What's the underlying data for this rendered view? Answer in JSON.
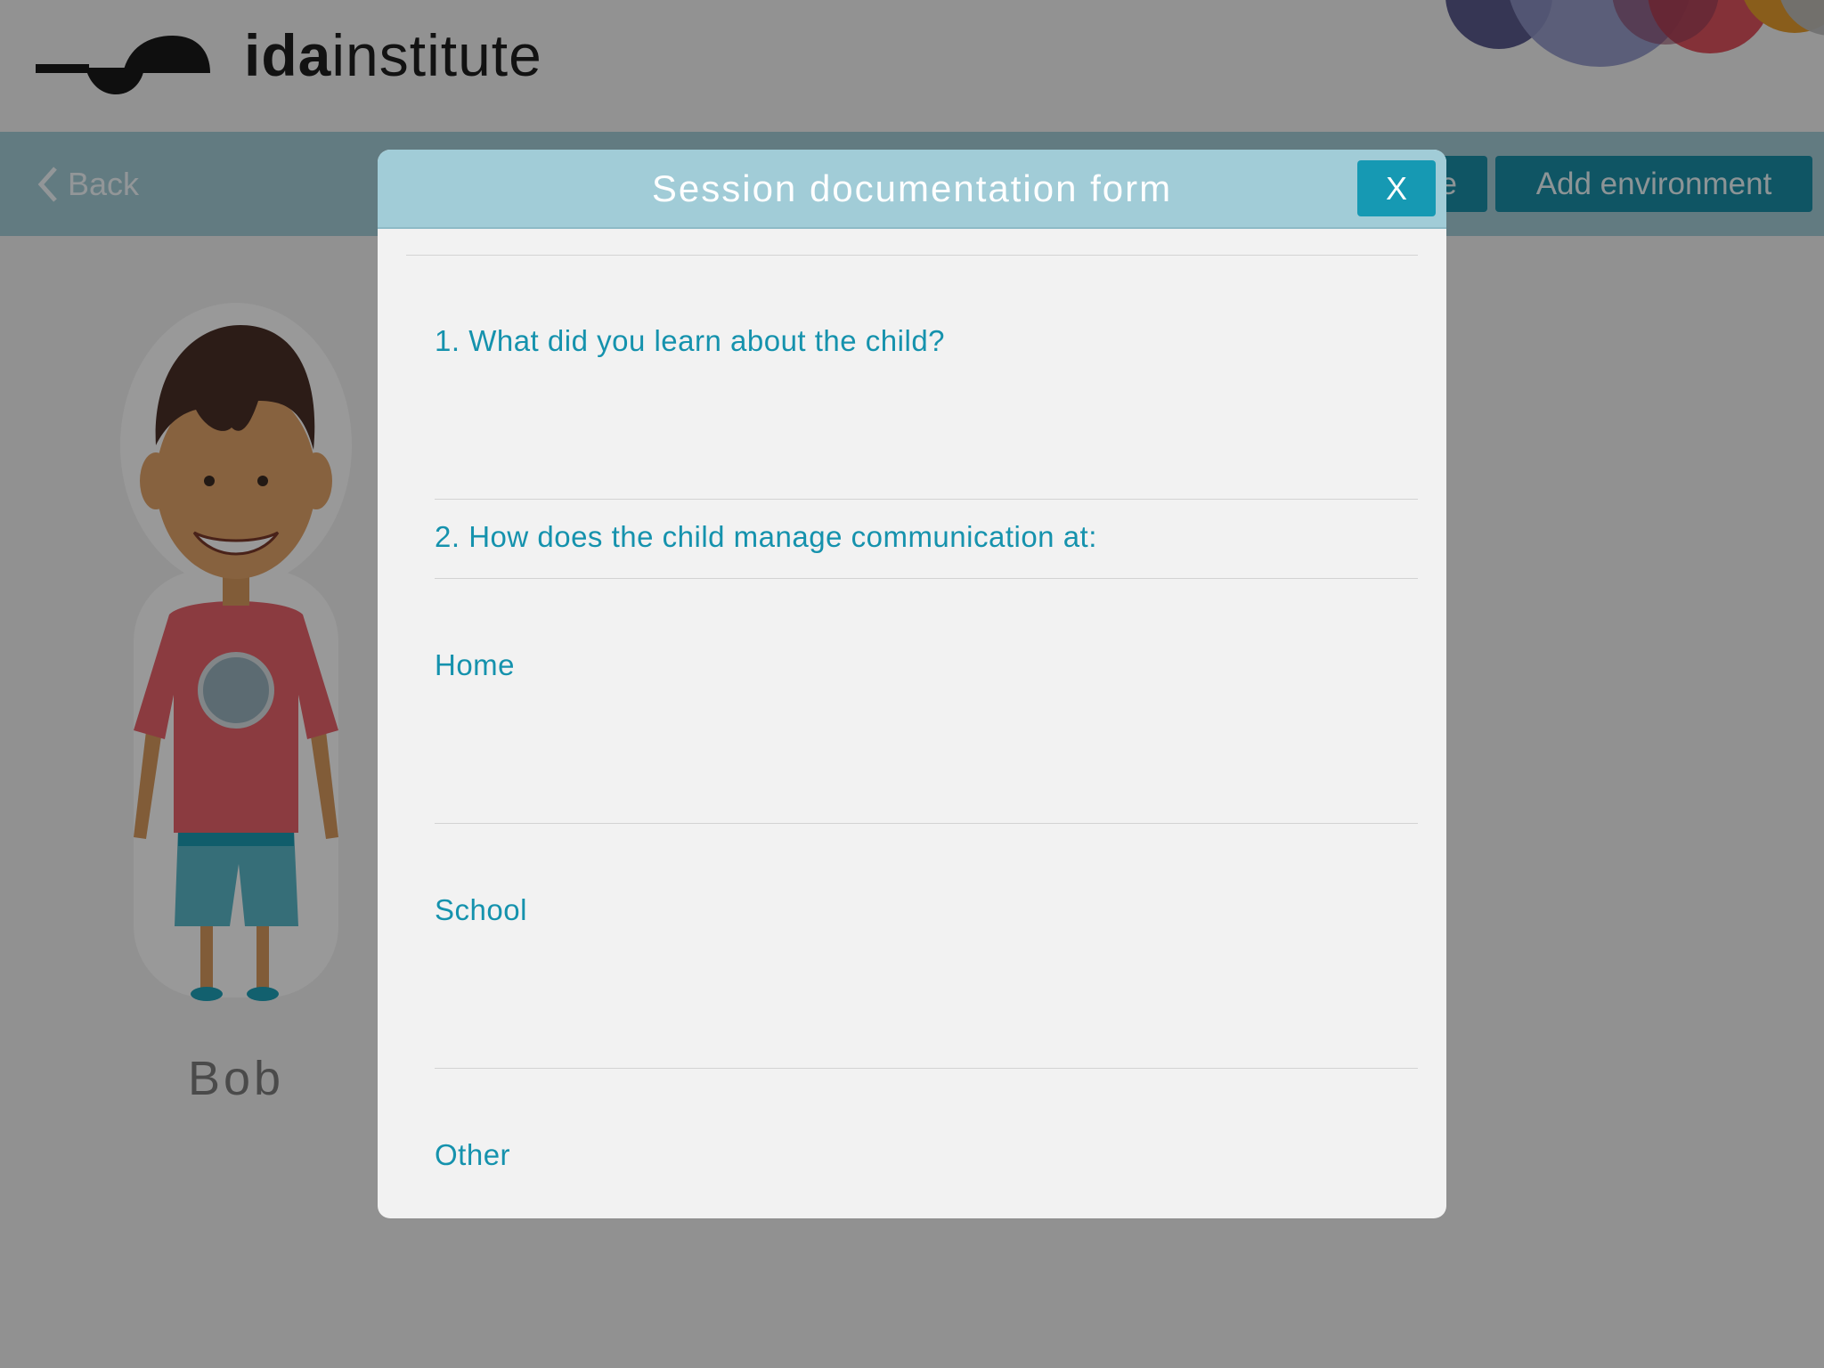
{
  "app": {
    "brand_bold": "ida",
    "brand_light": "institute"
  },
  "toolbar": {
    "back_label": "Back",
    "partial_button_label": "e",
    "add_environment_label": "Add environment"
  },
  "child": {
    "name": "Bob"
  },
  "modal": {
    "title": "Session documentation form",
    "close_label": "X",
    "question_1": "1. What did you learn about the child?",
    "question_2": "2. How does the child manage communication at:",
    "fields": [
      "Home",
      "School",
      "Other"
    ]
  },
  "colors": {
    "accent": "#1699b3",
    "modal_header": "#a1ccd7",
    "question_text": "#1592ad"
  }
}
